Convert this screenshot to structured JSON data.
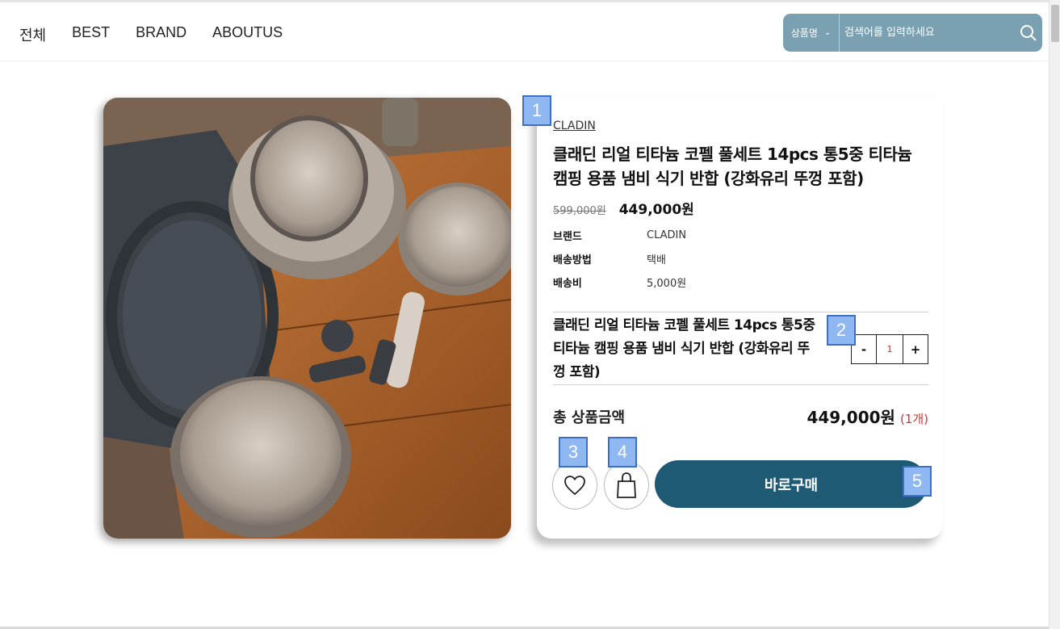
{
  "nav": {
    "items": [
      "전체",
      "BEST",
      "BRAND",
      "ABOUTUS"
    ]
  },
  "search": {
    "category": "상품명",
    "placeholder": "검색어를 입력하세요"
  },
  "product": {
    "brand": "CLADIN",
    "title": "클래딘 리얼 티타늄 코펠 풀세트 14pcs 통5중 티타늄 캠핑 용품 냄비 식기 반합 (강화유리 뚜껑 포함)",
    "original_price": "599,000원",
    "price": "449,000원",
    "info": [
      {
        "label": "브랜드",
        "value": "CLADIN"
      },
      {
        "label": "배송방법",
        "value": "택배"
      },
      {
        "label": "배송비",
        "value": "5,000원"
      }
    ],
    "option_name": "클래딘 리얼 티타늄 코펠 풀세트 14pcs 통5중 티타늄 캠핑 용품 냄비 식기 반합 (강화유리 뚜껑 포함)",
    "quantity": {
      "minus": "-",
      "value": "1",
      "plus": "+"
    },
    "total_label": "총 상품금액",
    "total_price": "449,000원",
    "total_count": "(1개)",
    "buy_label": "바로구매"
  },
  "markers": [
    "1",
    "2",
    "3",
    "4",
    "5"
  ],
  "icons": {
    "search": "search-icon",
    "wish": "heart-icon",
    "cart": "shopping-bag-icon"
  },
  "colors": {
    "accent": "#1e5a73",
    "search_bg": "#7aa0b1",
    "marker": "#8fb8f2"
  }
}
